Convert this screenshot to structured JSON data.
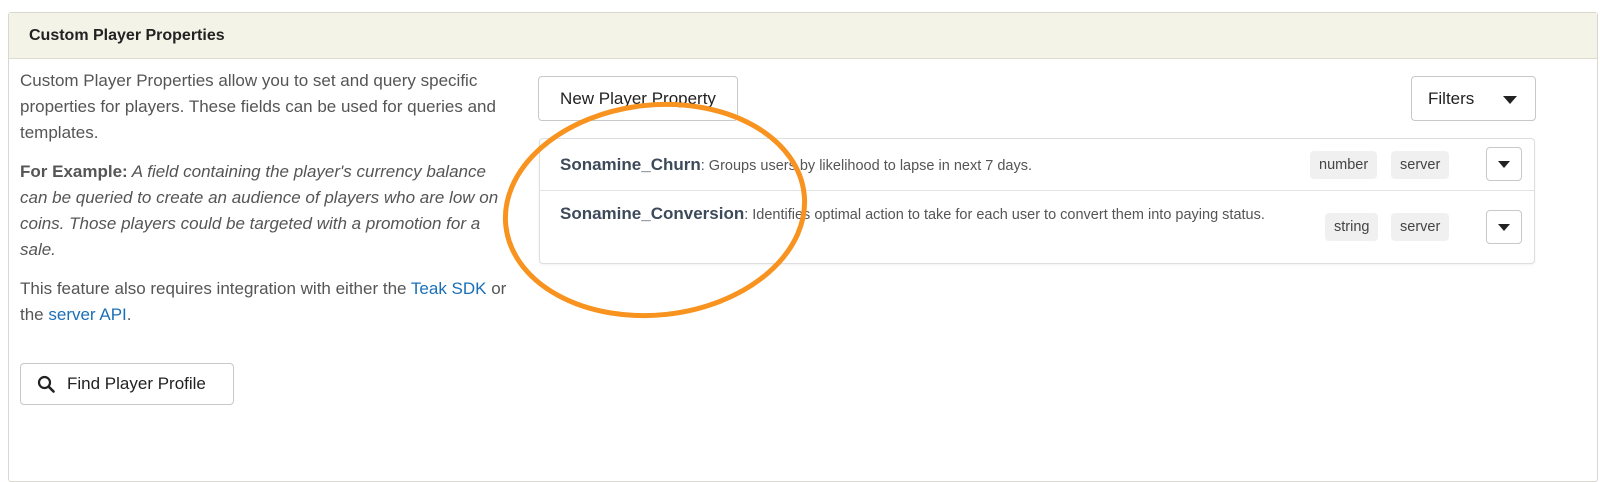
{
  "panel": {
    "title": "Custom Player Properties"
  },
  "intro": {
    "description": "Custom Player Properties allow you to set and query specific properties for players. These fields can be used for queries and templates.",
    "example_label": "For Example:",
    "example_text": " A field containing the player's currency balance can be queried to create an audience of players who are low on coins. Those players could be targeted with a promotion for a sale.",
    "integration_prefix": "This feature also requires integration with either the ",
    "link_sdk": "Teak SDK",
    "integration_middle": " or the ",
    "link_api": "server API",
    "integration_suffix": "."
  },
  "find_button": {
    "label": "Find Player Profile",
    "icon": "search-icon"
  },
  "toolbar": {
    "new_button": "New Player Property",
    "filters_button": "Filters"
  },
  "properties": [
    {
      "name": "Sonamine_Churn",
      "description": ": Groups users by likelihood to lapse in next 7 days.",
      "type": "number",
      "source": "server"
    },
    {
      "name": "Sonamine_Conversion",
      "description": ": Identifies optimal action to take for each user to convert them into paying status.",
      "type": "string",
      "source": "server"
    }
  ],
  "colors": {
    "header_bg": "#f3f3e7",
    "link": "#1a6fb8",
    "annotation": "#f7931e"
  }
}
